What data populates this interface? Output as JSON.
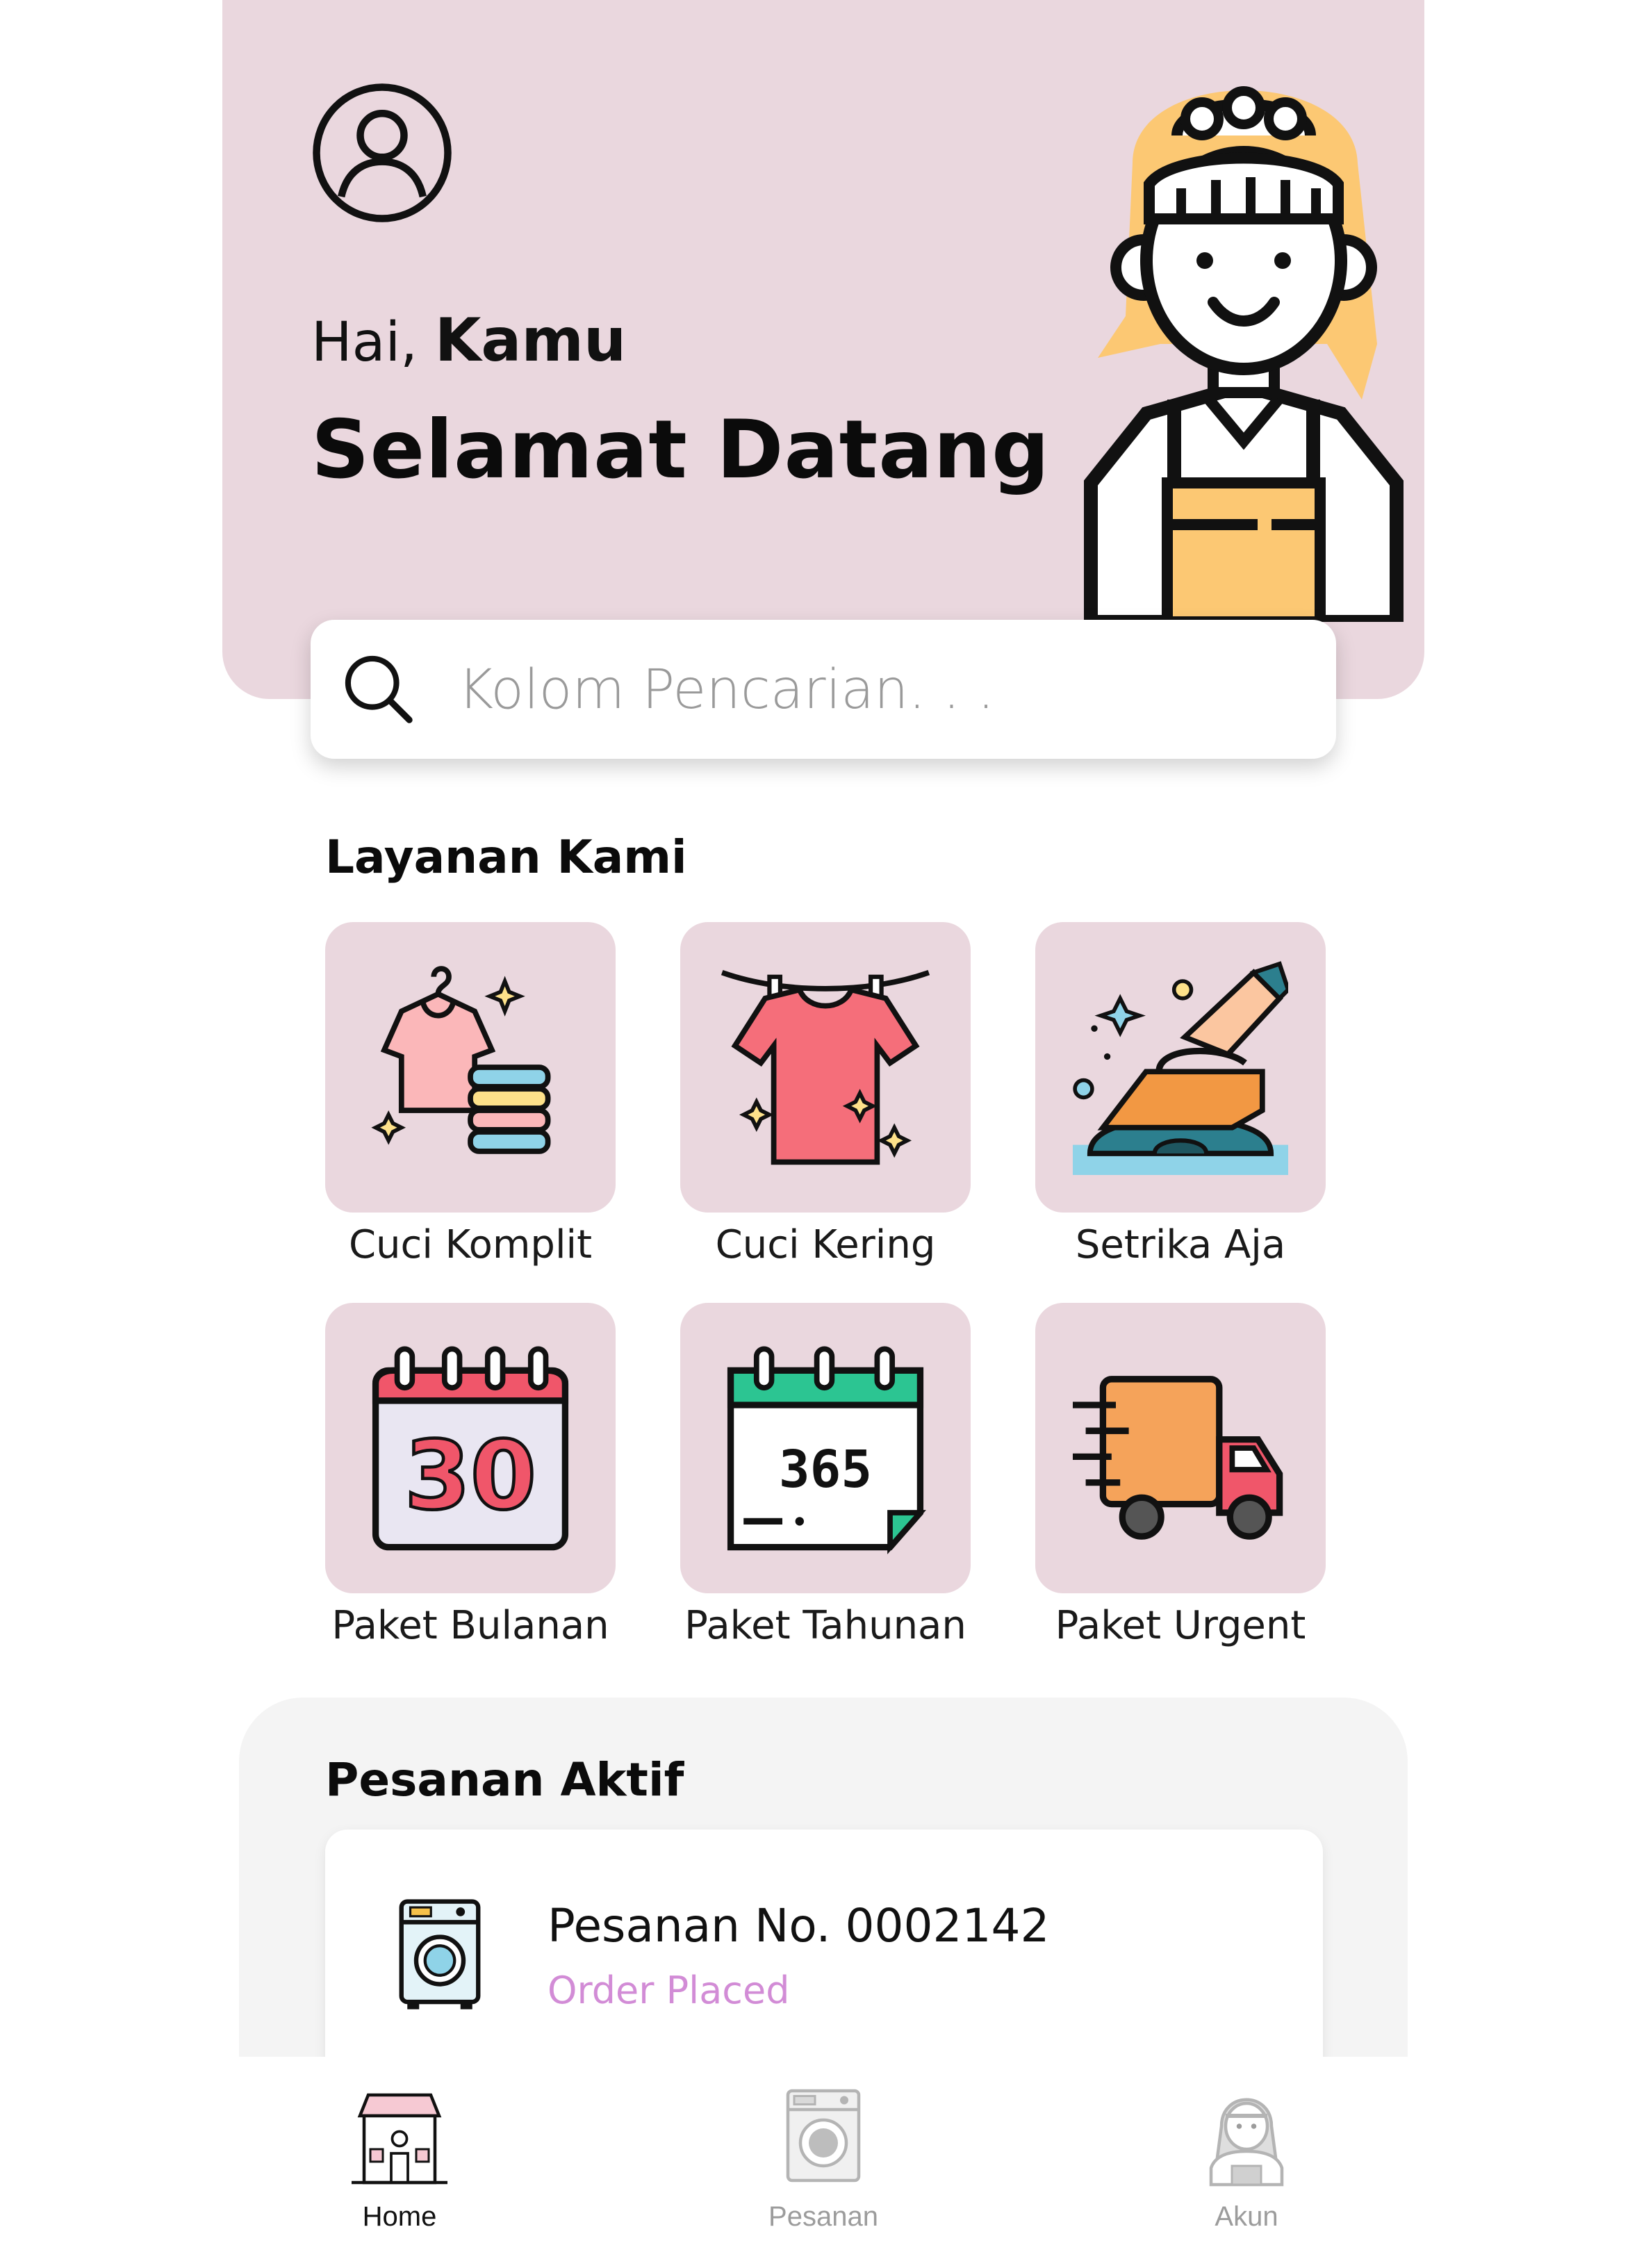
{
  "header": {
    "greeting": "Hai,",
    "name": "Kamu",
    "welcome": "Selamat Datang"
  },
  "search": {
    "placeholder": "Kolom Pencarian. . ."
  },
  "services": {
    "title": "Layanan Kami",
    "items": [
      {
        "label": "Cuci Komplit",
        "icon": "shirt-hanger-icon"
      },
      {
        "label": "Cuci Kering",
        "icon": "shirt-clothesline-icon"
      },
      {
        "label": "Setrika Aja",
        "icon": "iron-icon"
      },
      {
        "label": "Paket Bulanan",
        "icon": "calendar-30-icon"
      },
      {
        "label": "Paket Tahunan",
        "icon": "calendar-365-icon"
      },
      {
        "label": "Paket Urgent",
        "icon": "delivery-truck-icon"
      }
    ]
  },
  "active_orders": {
    "title": "Pesanan Aktif",
    "orders": [
      {
        "number": "Pesanan No. 0002142",
        "status": "Order Placed"
      }
    ]
  },
  "navbar": {
    "items": [
      {
        "label": "Home",
        "active": true
      },
      {
        "label": "Pesanan",
        "active": false
      },
      {
        "label": "Akun",
        "active": false
      }
    ]
  },
  "colors": {
    "hero_bg": "#ead7de",
    "tile_bg": "#ead7de",
    "status_pink": "#d28cd6",
    "inactive_nav": "#9c9c9c"
  }
}
